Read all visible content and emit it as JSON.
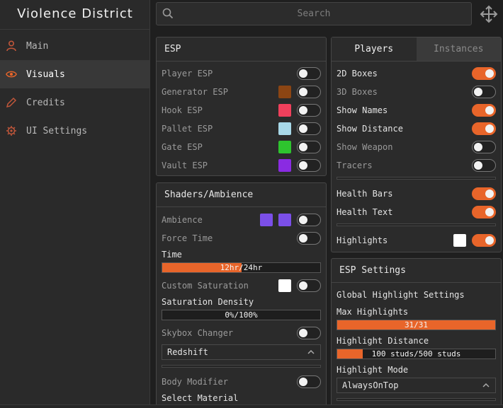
{
  "app": {
    "title": "Violence District"
  },
  "search": {
    "placeholder": "Search"
  },
  "sidebar": {
    "items": [
      {
        "label": "Main",
        "icon": "user-icon"
      },
      {
        "label": "Visuals",
        "icon": "eye-icon",
        "active": true
      },
      {
        "label": "Credits",
        "icon": "pencil-icon"
      },
      {
        "label": "UI Settings",
        "icon": "gear-icon"
      }
    ]
  },
  "colors": {
    "accent": "#e8652a"
  },
  "esp": {
    "title": "ESP",
    "rows": [
      {
        "label": "Player ESP",
        "enabled": false
      },
      {
        "label": "Generator ESP",
        "color": "#8b4513",
        "enabled": false
      },
      {
        "label": "Hook ESP",
        "color": "#f0405c",
        "enabled": false
      },
      {
        "label": "Pallet ESP",
        "color": "#a8d8e8",
        "enabled": false
      },
      {
        "label": "Gate ESP",
        "color": "#2ec42e",
        "enabled": false
      },
      {
        "label": "Vault ESP",
        "color": "#8a2be2",
        "enabled": false
      }
    ]
  },
  "shaders": {
    "title": "Shaders/Ambience",
    "ambience": {
      "label": "Ambience",
      "color1": "#7b4fe8",
      "color2": "#7b4fe8",
      "enabled": false
    },
    "force_time": {
      "label": "Force Time",
      "enabled": false
    },
    "time": {
      "label": "Time",
      "value_text": "12hr/24hr",
      "fraction": 0.5
    },
    "custom_saturation": {
      "label": "Custom Saturation",
      "color": "#ffffff",
      "enabled": false
    },
    "saturation_density": {
      "label": "Saturation Density",
      "value_text": "0%/100%",
      "fraction": 0
    },
    "skybox": {
      "label": "Skybox Changer",
      "enabled": false,
      "selected": "Redshift"
    },
    "body_modifier": {
      "label": "Body Modifier",
      "enabled": false
    },
    "select_material": {
      "label": "Select Material"
    }
  },
  "players": {
    "tabs": [
      "Players",
      "Instances"
    ],
    "rows": [
      {
        "label": "2D Boxes",
        "enabled": true
      },
      {
        "label": "3D Boxes",
        "enabled": false
      },
      {
        "label": "Show Names",
        "enabled": true
      },
      {
        "label": "Show Distance",
        "enabled": true
      },
      {
        "label": "Show Weapon",
        "enabled": false
      },
      {
        "label": "Tracers",
        "enabled": false
      }
    ],
    "rows2": [
      {
        "label": "Health Bars",
        "enabled": true
      },
      {
        "label": "Health Text",
        "enabled": true
      }
    ],
    "highlights": {
      "label": "Highlights",
      "color": "#ffffff",
      "enabled": true
    }
  },
  "esp_settings": {
    "title": "ESP Settings",
    "global_label": "Global Highlight Settings",
    "max_highlights": {
      "label": "Max Highlights",
      "value_text": "31/31",
      "fraction": 1
    },
    "highlight_distance": {
      "label": "Highlight Distance",
      "value_text": "100 studs/500 studs",
      "fraction": 0.16
    },
    "highlight_mode": {
      "label": "Highlight Mode",
      "selected": "AlwaysOnTop"
    }
  }
}
